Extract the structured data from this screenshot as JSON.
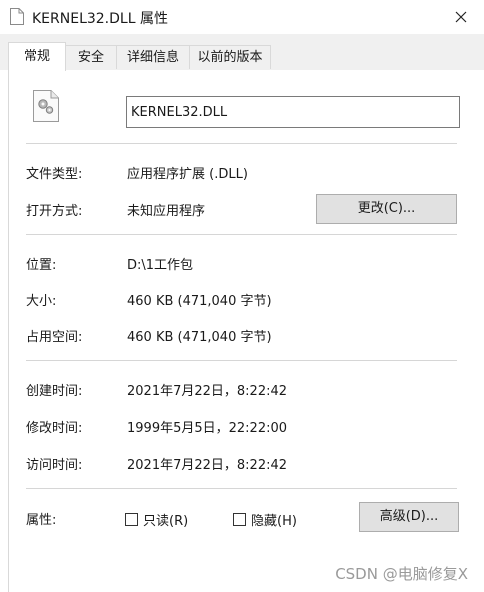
{
  "window": {
    "title": "KERNEL32.DLL 属性"
  },
  "tabs": [
    {
      "label": "常规",
      "active": true
    },
    {
      "label": "安全"
    },
    {
      "label": "详细信息"
    },
    {
      "label": "以前的版本"
    }
  ],
  "general": {
    "file_name": "KERNEL32.DLL",
    "file_type_label": "文件类型:",
    "file_type_value": "应用程序扩展 (.DLL)",
    "open_with_label": "打开方式:",
    "open_with_value": "未知应用程序",
    "change_button": "更改(C)...",
    "location_label": "位置:",
    "location_value": "D:\\1工作包",
    "size_label": "大小:",
    "size_value": "460 KB (471,040 字节)",
    "size_on_disk_label": "占用空间:",
    "size_on_disk_value": "460 KB (471,040 字节)",
    "created_label": "创建时间:",
    "created_value": "2021年7月22日，8:22:42",
    "modified_label": "修改时间:",
    "modified_value": "1999年5月5日，22:22:00",
    "accessed_label": "访问时间:",
    "accessed_value": "2021年7月22日，8:22:42",
    "attributes_label": "属性:",
    "readonly_label": "只读(R)",
    "hidden_label": "隐藏(H)",
    "advanced_button": "高级(D)..."
  },
  "watermark": "CSDN @电脑修复X",
  "colors": {
    "tab_bg": "#f0f0f0",
    "button_bg": "#e1e1e1",
    "separator": "#d6d6d6"
  }
}
